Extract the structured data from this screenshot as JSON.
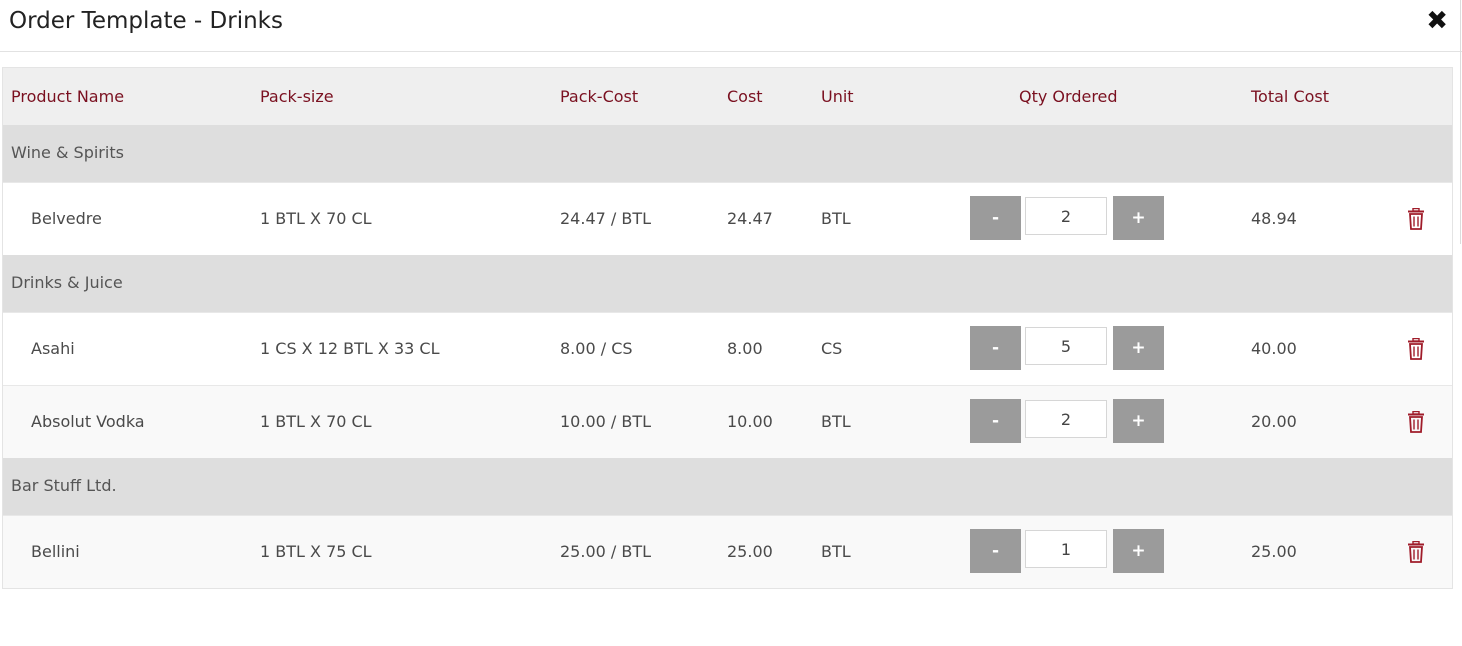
{
  "modal": {
    "title": "Order Template - Drinks",
    "close_label": "✖"
  },
  "headers": {
    "product_name": "Product Name",
    "pack_size": "Pack-size",
    "pack_cost": "Pack-Cost",
    "cost": "Cost",
    "unit": "Unit",
    "qty_ordered": "Qty Ordered",
    "total_cost": "Total Cost"
  },
  "stepper": {
    "minus": "-",
    "plus": "+"
  },
  "groups": [
    {
      "name": "Wine & Spirits",
      "items": [
        {
          "name": "Belvedre",
          "pack_size": "1 BTL X 70 CL",
          "pack_cost": "24.47 / BTL",
          "cost": "24.47",
          "unit": "BTL",
          "qty": "2",
          "total": "48.94"
        }
      ]
    },
    {
      "name": "Drinks & Juice",
      "items": [
        {
          "name": "Asahi",
          "pack_size": "1 CS X 12 BTL X 33 CL",
          "pack_cost": "8.00 / CS",
          "cost": "8.00",
          "unit": "CS",
          "qty": "5",
          "total": "40.00"
        },
        {
          "name": "Absolut Vodka",
          "pack_size": "1 BTL X 70 CL",
          "pack_cost": "10.00 / BTL",
          "cost": "10.00",
          "unit": "BTL",
          "qty": "2",
          "total": "20.00"
        }
      ]
    },
    {
      "name": "Bar Stuff Ltd.",
      "items": [
        {
          "name": "Bellini",
          "pack_size": "1 BTL X 75 CL",
          "pack_cost": "25.00 / BTL",
          "cost": "25.00",
          "unit": "BTL",
          "qty": "1",
          "total": "25.00"
        }
      ]
    }
  ],
  "colors": {
    "header_text": "#7a1020",
    "trash_icon": "#a01c2a",
    "stepper_button": "#9b9b9b"
  }
}
